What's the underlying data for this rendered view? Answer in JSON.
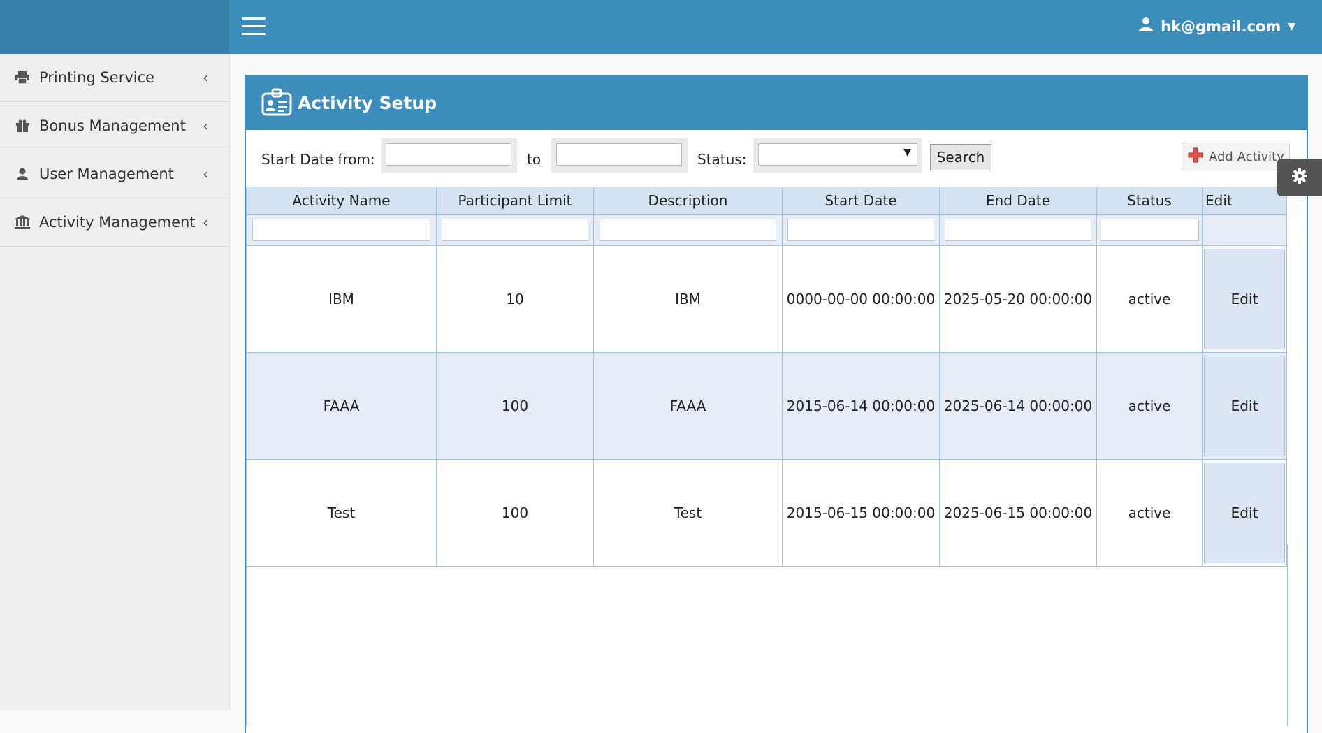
{
  "header": {
    "user_email": "hk@gmail.com"
  },
  "sidebar": {
    "items": [
      {
        "label": "Printing Service",
        "icon": "printer-icon"
      },
      {
        "label": "Bonus Management",
        "icon": "gift-icon"
      },
      {
        "label": "User Management",
        "icon": "user-icon"
      },
      {
        "label": "Activity Management",
        "icon": "bank-icon"
      }
    ]
  },
  "panel": {
    "title": "Activity Setup"
  },
  "filters": {
    "start_date_from_label": "Start Date from:",
    "to_label": "to",
    "status_label": "Status:",
    "start_date_from_value": "",
    "start_date_to_value": "",
    "status_value": "",
    "search_label": "Search",
    "add_activity_label": "Add Activity"
  },
  "table": {
    "columns": [
      "Activity Name",
      "Participant Limit",
      "Description",
      "Start Date",
      "End Date",
      "Status",
      "Edit"
    ],
    "rows": [
      {
        "name": "IBM",
        "limit": "10",
        "description": "IBM",
        "start": "0000-00-00 00:00:00",
        "end": "2025-05-20 00:00:00",
        "status": "active",
        "edit": "Edit"
      },
      {
        "name": "FAAA",
        "limit": "100",
        "description": "FAAA",
        "start": "2015-06-14 00:00:00",
        "end": "2025-06-14 00:00:00",
        "status": "active",
        "edit": "Edit"
      },
      {
        "name": "Test",
        "limit": "100",
        "description": "Test",
        "start": "2015-06-15 00:00:00",
        "end": "2025-06-15 00:00:00",
        "status": "active",
        "edit": "Edit"
      }
    ]
  },
  "colors": {
    "primary": "#3c8dbc",
    "primary_dark": "#367fa9",
    "sidebar_bg": "#eeeeee",
    "table_header": "#d5e2f1",
    "row_alt": "#e6ecf6"
  }
}
